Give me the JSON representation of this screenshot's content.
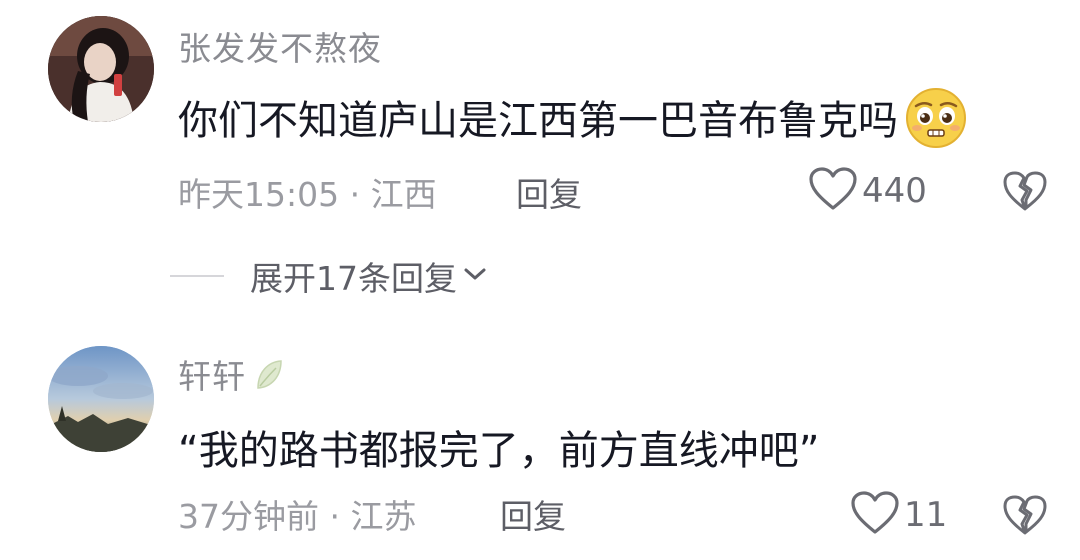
{
  "comments": [
    {
      "username": "张发发不熬夜",
      "text": "你们不知道庐山是江西第一巴音布鲁克吗",
      "meta": "昨天15:05 · 江西",
      "reply_label": "回复",
      "like_count": "440",
      "emoji": "pleading-face-emoji",
      "expand_label": "展开17条回复"
    },
    {
      "username": "轩轩",
      "text": "“我的路书都报完了，前方直线冲吧”",
      "meta": "37分钟前 · 江苏",
      "reply_label": "回复",
      "like_count": "11"
    }
  ],
  "icons": {
    "like": "heart-outline-icon",
    "dislike": "broken-heart-icon",
    "expand": "chevron-down-icon",
    "badge": "leaf-icon"
  },
  "colors": {
    "primary_text": "#161823",
    "secondary_text": "#8a8b91",
    "reply_text": "#5d5e66"
  }
}
